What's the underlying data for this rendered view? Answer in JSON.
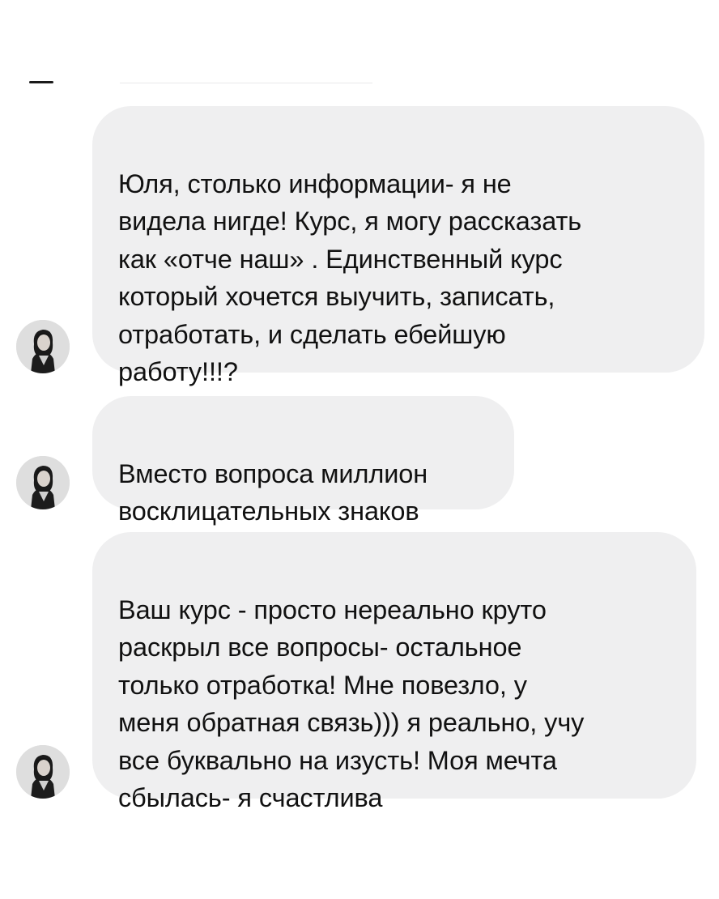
{
  "conversation": {
    "messages": [
      {
        "sender": "incoming",
        "avatar_icon": "woman-portrait-avatar",
        "text": "Юля, столько информации- я не\nвидела нигде! Курс, я могу рассказать\nкак «отче наш» . Единственный курс\nкоторый хочется выучить, записать,\nотработать, и сделать ебейшую\nработу!!!?"
      },
      {
        "sender": "incoming",
        "avatar_icon": "woman-portrait-avatar",
        "text": "Вместо вопроса миллион\nвосклицательных знаков"
      },
      {
        "sender": "incoming",
        "avatar_icon": "woman-portrait-avatar",
        "text": "Ваш курс - просто нереально круто\nраскрыл все вопросы- остальное\nтолько отработка! Мне повезло, у\nменя обратная связь))) я реально, учу\nвсе буквально на изусть! Моя мечта\nсбылась- я счастлива"
      }
    ]
  },
  "colors": {
    "bubble_background": "#efeff0",
    "text": "#111111",
    "page_background": "#ffffff"
  }
}
